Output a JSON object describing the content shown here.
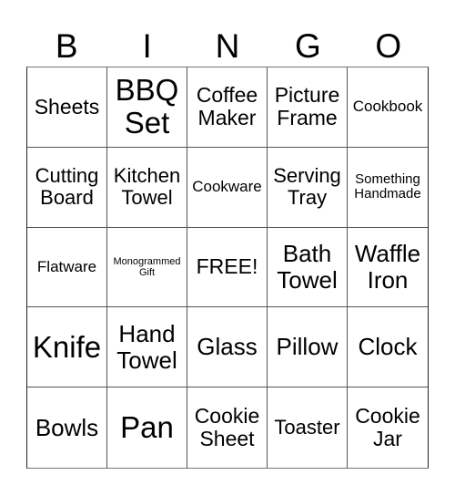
{
  "header": {
    "letters": [
      "B",
      "I",
      "N",
      "G",
      "O"
    ]
  },
  "card": {
    "free_space_index": 12,
    "cells": [
      {
        "text": "Sheets",
        "size": "m"
      },
      {
        "text": "BBQ Set",
        "size": "xl"
      },
      {
        "text": "Coffee Maker",
        "size": "m"
      },
      {
        "text": "Picture Frame",
        "size": "m"
      },
      {
        "text": "Cookbook",
        "size": "s"
      },
      {
        "text": "Cutting Board",
        "size": "md"
      },
      {
        "text": "Kitchen Towel",
        "size": "md"
      },
      {
        "text": "Cookware",
        "size": "s"
      },
      {
        "text": "Serving Tray",
        "size": "md"
      },
      {
        "text": "Something Handmade",
        "size": "xs"
      },
      {
        "text": "Flatware",
        "size": "s"
      },
      {
        "text": "Monogrammed Gift",
        "size": "xxs"
      },
      {
        "text": "FREE!",
        "size": "m"
      },
      {
        "text": "Bath Towel",
        "size": "l"
      },
      {
        "text": "Waffle Iron",
        "size": "l"
      },
      {
        "text": "Knife",
        "size": "xl"
      },
      {
        "text": "Hand Towel",
        "size": "l"
      },
      {
        "text": "Glass",
        "size": "l"
      },
      {
        "text": "Pillow",
        "size": "l"
      },
      {
        "text": "Clock",
        "size": "l"
      },
      {
        "text": "Bowls",
        "size": "l"
      },
      {
        "text": "Pan",
        "size": "xl"
      },
      {
        "text": "Cookie Sheet",
        "size": "m"
      },
      {
        "text": "Toaster",
        "size": "md"
      },
      {
        "text": "Cookie Jar",
        "size": "m"
      }
    ]
  }
}
